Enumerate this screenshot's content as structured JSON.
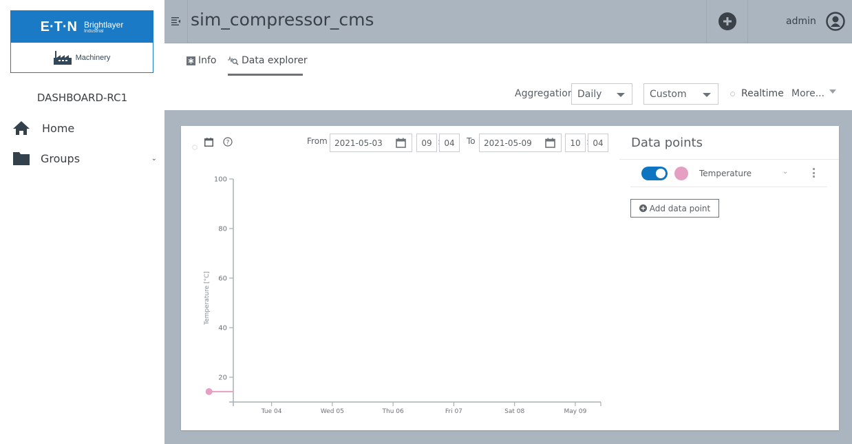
{
  "sidebar": {
    "logo": {
      "brand": "E·T·N",
      "product": "Brightlayer",
      "product_sub": "Industrial",
      "module": "Machinery"
    },
    "dashboard_name": "DASHBOARD-RC1",
    "items": [
      {
        "label": "Home",
        "icon": "home-icon"
      },
      {
        "label": "Groups",
        "icon": "folder-icon",
        "expandable": true
      }
    ]
  },
  "header": {
    "title": "sim_compressor_cms",
    "user": "admin"
  },
  "tabs": [
    {
      "label": "Info",
      "icon": "info-icon",
      "active": false
    },
    {
      "label": "Data explorer",
      "icon": "data-explorer-icon",
      "active": true
    }
  ],
  "toolbar": {
    "aggregation_label": "Aggregation",
    "aggregation_value": "Daily",
    "range_value": "Custom",
    "realtime_label": "Realtime",
    "more_label": "More..."
  },
  "range": {
    "from_label": "From",
    "from_date": "2021-05-03",
    "from_hour": "09",
    "from_minute": "04",
    "to_label": "To",
    "to_date": "2021-05-09",
    "to_hour": "10",
    "to_minute": "04",
    "separator": ":"
  },
  "datapoints": {
    "title": "Data points",
    "items": [
      {
        "name": "Temperature",
        "enabled": true,
        "color": "#e59fc3"
      }
    ],
    "add_label": "Add data point"
  },
  "chart_data": {
    "type": "line",
    "title": "",
    "xlabel": "",
    "ylabel": "Temperature [°C]",
    "ylim": [
      10,
      100
    ],
    "yticks": [
      20,
      40,
      60,
      80,
      100
    ],
    "x_tick_labels": [
      "Tue 04",
      "Wed 05",
      "Thu 06",
      "Fri 07",
      "Sat 08",
      "May 09"
    ],
    "xlim_days": [
      0,
      6.05
    ],
    "x_tick_positions_days": [
      0.63,
      1.63,
      2.63,
      3.63,
      4.63,
      5.63
    ],
    "series": [
      {
        "name": "Temperature",
        "color": "#e59fc3",
        "points": [
          {
            "x_days": -0.4,
            "y": 14.2
          },
          {
            "x_days": 0.0,
            "y": 14.2
          }
        ]
      }
    ],
    "grid": false,
    "legend": "none"
  }
}
